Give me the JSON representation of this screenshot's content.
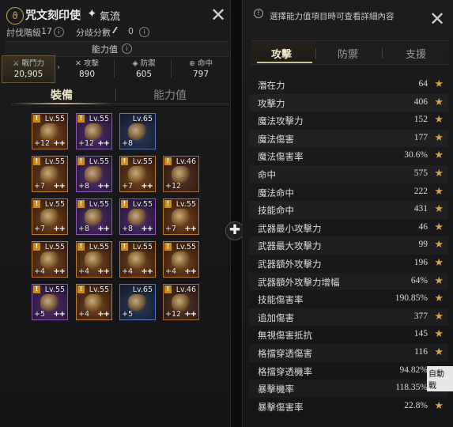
{
  "header": {
    "class_name": "咒文刻印使",
    "spec_name": "氣流",
    "hunt_label": "討伐階級",
    "hunt_value": "17",
    "branch_label": "分歧分數",
    "branch_value": "0"
  },
  "ability_section_label": "能力值",
  "stats": {
    "power_label": "戰鬥力",
    "power_value": "20,905",
    "attack_label": "攻擊",
    "attack_value": "890",
    "defense_label": "防禦",
    "defense_value": "605",
    "hit_label": "命中",
    "hit_value": "797"
  },
  "left_tabs": {
    "equip": "裝備",
    "ability": "能力值"
  },
  "items": [
    {
      "level": "Lv.55",
      "enh": "+12",
      "pp": "++",
      "rarity": "hi",
      "warn": true
    },
    {
      "level": "Lv.55",
      "enh": "+12",
      "pp": "++",
      "rarity": "ep",
      "warn": true
    },
    {
      "level": "Lv.65",
      "enh": "+8",
      "pp": "",
      "rarity": "rl",
      "warn": false
    },
    {
      "level": "Lv.55",
      "enh": "+7",
      "pp": "++",
      "rarity": "hi",
      "warn": true
    },
    {
      "level": "Lv.55",
      "enh": "+8",
      "pp": "++",
      "rarity": "ep",
      "warn": true
    },
    {
      "level": "Lv.55",
      "enh": "+7",
      "pp": "++",
      "rarity": "hi",
      "warn": true
    },
    {
      "level": "Lv.46",
      "enh": "+12",
      "pp": "",
      "rarity": "le",
      "warn": true
    },
    {
      "level": "Lv.55",
      "enh": "+7",
      "pp": "++",
      "rarity": "hi",
      "warn": true
    },
    {
      "level": "Lv.55",
      "enh": "+8",
      "pp": "++",
      "rarity": "ep",
      "warn": true
    },
    {
      "level": "Lv.55",
      "enh": "+8",
      "pp": "++",
      "rarity": "ep",
      "warn": true
    },
    {
      "level": "Lv.55",
      "enh": "+7",
      "pp": "++",
      "rarity": "hi",
      "warn": true
    },
    {
      "level": "Lv.55",
      "enh": "+4",
      "pp": "++",
      "rarity": "hi",
      "warn": true
    },
    {
      "level": "Lv.55",
      "enh": "+4",
      "pp": "++",
      "rarity": "hi",
      "warn": true
    },
    {
      "level": "Lv.55",
      "enh": "+4",
      "pp": "++",
      "rarity": "hi",
      "warn": true
    },
    {
      "level": "Lv.55",
      "enh": "+4",
      "pp": "++",
      "rarity": "hi",
      "warn": true
    },
    {
      "level": "Lv.55",
      "enh": "+5",
      "pp": "++",
      "rarity": "ep",
      "warn": true
    },
    {
      "level": "Lv.55",
      "enh": "+4",
      "pp": "++",
      "rarity": "hi",
      "warn": true
    },
    {
      "level": "Lv.65",
      "enh": "+5",
      "pp": "",
      "rarity": "rl",
      "warn": false
    },
    {
      "level": "Lv.46",
      "enh": "+12",
      "pp": "++",
      "rarity": "le",
      "warn": true
    }
  ],
  "right": {
    "hint": "選擇能力值項目時可查看詳細內容",
    "tabs": [
      "攻擊",
      "防禦",
      "支援"
    ],
    "stats": [
      {
        "name": "潛在力",
        "value": "64"
      },
      {
        "name": "攻擊力",
        "value": "406"
      },
      {
        "name": "魔法攻擊力",
        "value": "152"
      },
      {
        "name": "魔法傷害",
        "value": "177"
      },
      {
        "name": "魔法傷害率",
        "value": "30.6%"
      },
      {
        "name": "命中",
        "value": "575"
      },
      {
        "name": "魔法命中",
        "value": "222"
      },
      {
        "name": "技能命中",
        "value": "431"
      },
      {
        "name": "武器最小攻擊力",
        "value": "46"
      },
      {
        "name": "武器最大攻擊力",
        "value": "99"
      },
      {
        "name": "武器額外攻擊力",
        "value": "196"
      },
      {
        "name": "武器額外攻擊力增幅",
        "value": "64%"
      },
      {
        "name": "技能傷害率",
        "value": "190.85%"
      },
      {
        "name": "追加傷害",
        "value": "377"
      },
      {
        "name": "無視傷害抵抗",
        "value": "145"
      },
      {
        "name": "格擋穿透傷害",
        "value": "116"
      },
      {
        "name": "格擋穿透機率",
        "value": "94.82%"
      },
      {
        "name": "暴擊機率",
        "value": "118.35%"
      },
      {
        "name": "暴擊傷害率",
        "value": "22.8%"
      }
    ]
  },
  "tooltip": "自動戰"
}
